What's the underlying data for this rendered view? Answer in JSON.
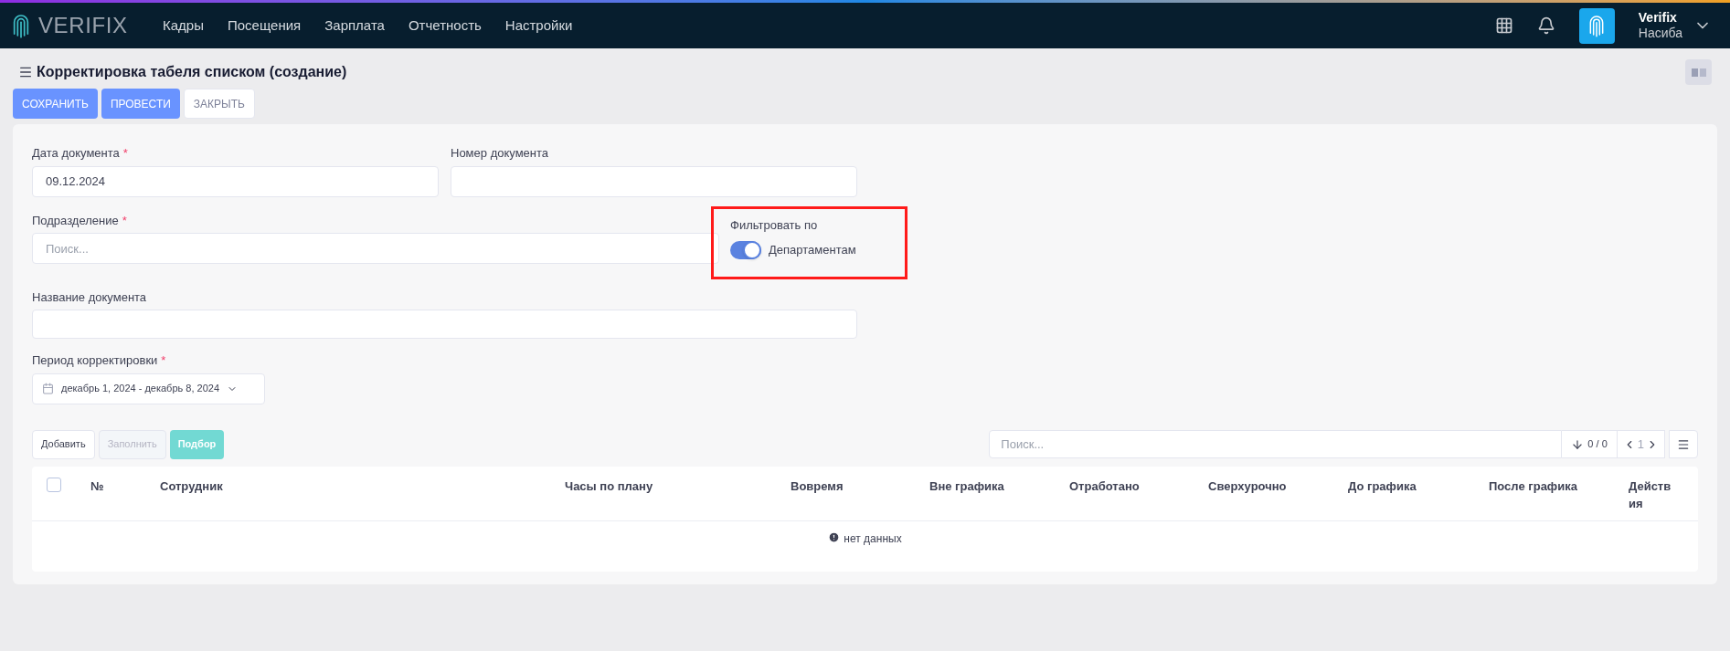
{
  "header": {
    "logo": "VERIFIX",
    "nav": [
      {
        "label": "Кадры",
        "selected": false
      },
      {
        "label": "Посещения",
        "selected": false
      },
      {
        "label": "Зарплата",
        "selected": false
      },
      {
        "label": "Отчетность",
        "selected": false
      },
      {
        "label": "Настройки",
        "selected": false
      }
    ],
    "user": {
      "company": "Verifix",
      "name": "Насиба"
    }
  },
  "page": {
    "title": "Корректировка табеля списком (создание)",
    "actions": [
      {
        "label": "СОХРАНИТЬ",
        "kind": "primary"
      },
      {
        "label": "ПРОВЕСТИ",
        "kind": "primary"
      },
      {
        "label": "ЗАКРЫТЬ",
        "kind": "default"
      }
    ]
  },
  "form": {
    "date": {
      "label": "Дата документа",
      "required_mark": "*",
      "value": "09.12.2024"
    },
    "number": {
      "label": "Номер документа"
    },
    "division": {
      "label": "Подразделение",
      "required_mark": "*",
      "placeholder": "Поиск..."
    },
    "filter": {
      "label": "Фильтровать по",
      "toggle_label": "Департаментам",
      "on": true
    },
    "name": {
      "label": "Название документа"
    },
    "period": {
      "label": "Период корректировки",
      "required_mark": "*",
      "value": "декабрь 1, 2024 - декабрь 8, 2024"
    }
  },
  "table": {
    "buttons": [
      {
        "label": "Добавить",
        "kind": "default"
      },
      {
        "label": "Заполнить",
        "kind": "disabled"
      },
      {
        "label": "Подбор",
        "kind": "teal"
      }
    ],
    "search": {
      "placeholder": "Поиск..."
    },
    "count": "0 / 0",
    "page": "1",
    "select_all": {
      "checked": false
    },
    "columns": [
      "№",
      "Сотрудник",
      "Часы по плану",
      "Вовремя",
      "Вне графика",
      "Отработано",
      "Сверхурочно",
      "До графика",
      "После графика",
      "Действия"
    ],
    "empty": "нет данных"
  }
}
